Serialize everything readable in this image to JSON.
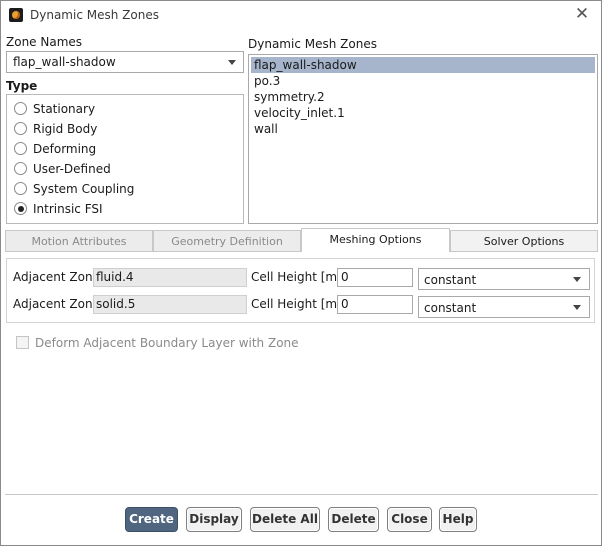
{
  "window": {
    "title": "Dynamic Mesh Zones",
    "close_glyph": "✕"
  },
  "zone_names": {
    "label": "Zone Names",
    "selected": "flap_wall-shadow"
  },
  "type": {
    "label": "Type",
    "options": [
      {
        "label": "Stationary",
        "checked": false
      },
      {
        "label": "Rigid Body",
        "checked": false
      },
      {
        "label": "Deforming",
        "checked": false
      },
      {
        "label": "User-Defined",
        "checked": false
      },
      {
        "label": "System Coupling",
        "checked": false
      },
      {
        "label": "Intrinsic FSI",
        "checked": true
      }
    ]
  },
  "dynamic_mesh_zones": {
    "label": "Dynamic Mesh Zones",
    "items": [
      "flap_wall-shadow",
      "po.3",
      "symmetry.2",
      "velocity_inlet.1",
      "wall"
    ],
    "selected_index": 0
  },
  "tabs": [
    {
      "label": "Motion Attributes",
      "active": false
    },
    {
      "label": "Geometry Definition",
      "active": false
    },
    {
      "label": "Meshing Options",
      "active": true
    },
    {
      "label": "Solver Options",
      "active": false
    }
  ],
  "meshing_rows": [
    {
      "adjacent_label": "Adjacent Zone",
      "adjacent_value": "fluid.4",
      "height_label": "Cell Height [m]",
      "height_value": "0",
      "method": "constant"
    },
    {
      "adjacent_label": "Adjacent Zone",
      "adjacent_value": "solid.5",
      "height_label": "Cell Height [m]",
      "height_value": "0",
      "method": "constant"
    }
  ],
  "deform_checkbox": {
    "label": "Deform Adjacent Boundary Layer with Zone",
    "checked": false,
    "enabled": false
  },
  "buttons": {
    "create": "Create",
    "display": "Display",
    "delete_all": "Delete All",
    "delete": "Delete",
    "close": "Close",
    "help": "Help"
  },
  "colors": {
    "selection": "#a6b5cc",
    "primary_button": "#4f6580",
    "app_icon": "#e8a030"
  }
}
